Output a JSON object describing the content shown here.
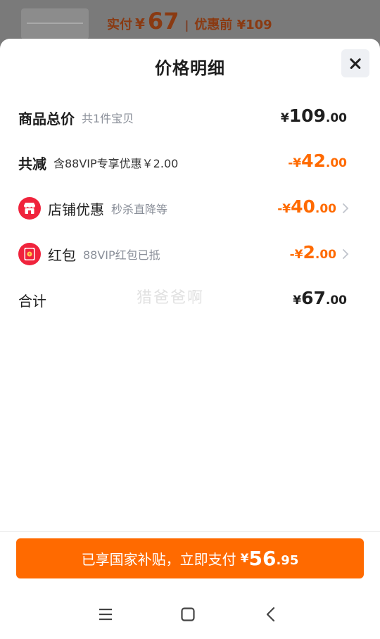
{
  "background": {
    "paid_label": "实付",
    "paid_yen": "¥",
    "paid_amount": "67",
    "separator": "|",
    "original_label": "优惠前 ¥109"
  },
  "sheet": {
    "title": "价格明细"
  },
  "rows": {
    "subtotal": {
      "label": "商品总价",
      "sub": "共1件宝贝",
      "yen": "¥",
      "int": "109",
      "dec": ".00"
    },
    "discount": {
      "label": "共减",
      "sub": "含88VIP专享优惠￥2.00",
      "yen": "-¥",
      "int": "42",
      "dec": ".00"
    },
    "store": {
      "label": "店铺优惠",
      "sub": "秒杀直降等",
      "yen": "-¥",
      "int": "40",
      "dec": ".00"
    },
    "redpacket": {
      "label": "红包",
      "sub": "88VIP红包已抵",
      "yen": "-¥",
      "int": "2",
      "dec": ".00"
    },
    "total": {
      "label": "合计",
      "yen": "¥",
      "int": "67",
      "dec": ".00"
    }
  },
  "watermark": "猎爸爸啊",
  "pay_button": {
    "text": "已享国家补贴，立即支付",
    "yen": "¥",
    "int": "56",
    "dec": ".95"
  },
  "colors": {
    "accent": "#ff6a00",
    "icon_red": "#f0233c"
  },
  "icons": {
    "close": "close-icon",
    "store": "store-icon",
    "redpacket": "red-packet-icon",
    "chevron": "chevron-right-icon",
    "menu": "menu-icon",
    "home": "home-icon",
    "back": "back-icon"
  }
}
